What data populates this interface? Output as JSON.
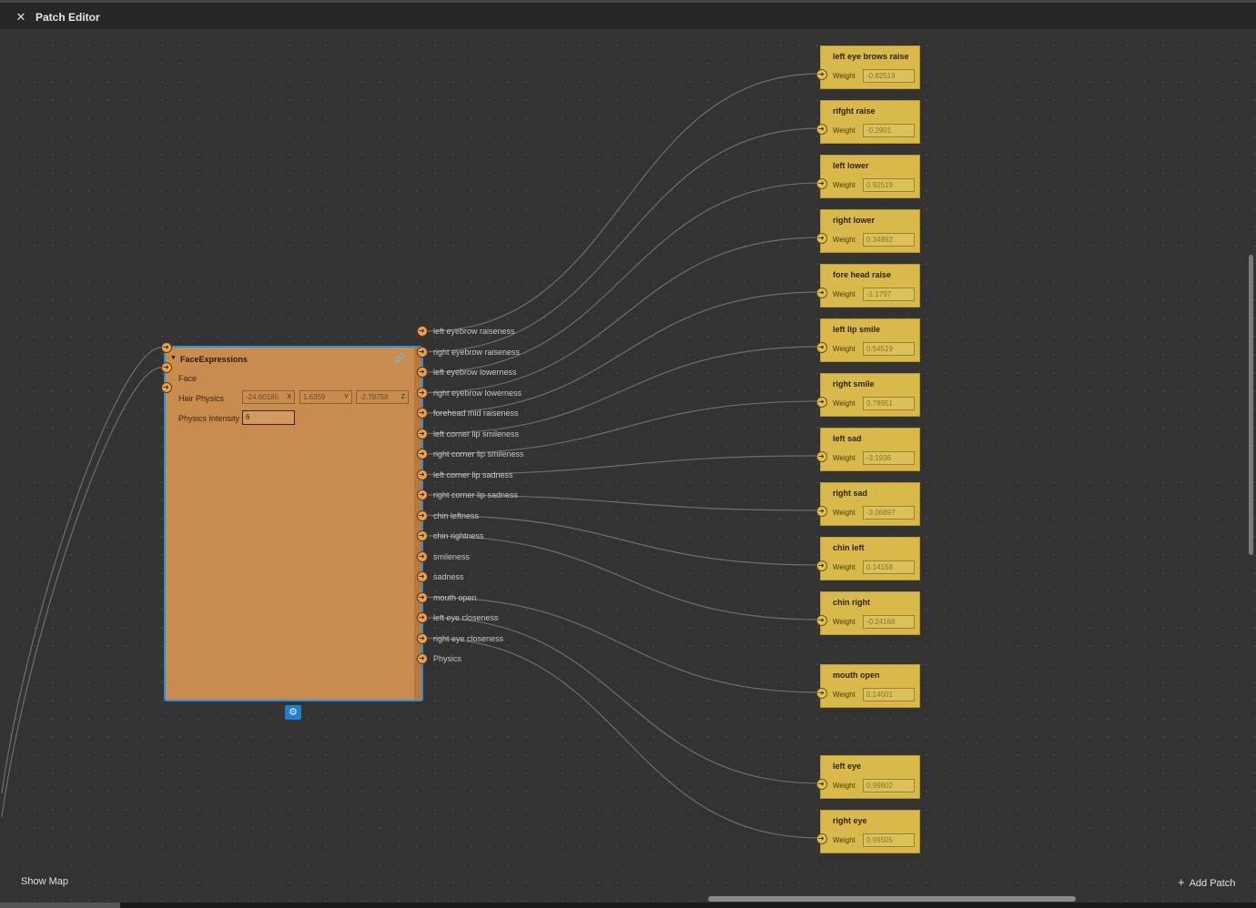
{
  "window": {
    "title": "Patch Editor"
  },
  "face_node": {
    "title": "FaceExpressions",
    "inputs": [
      {
        "label": "Face"
      },
      {
        "label": "Hair Physics",
        "x": "-24.60185",
        "y": "1.6359",
        "z": "-2.78758",
        "x_axis": "X",
        "y_axis": "Y",
        "z_axis": "Z"
      },
      {
        "label": "Physics Intensity",
        "value": "6"
      }
    ],
    "outputs": [
      "left eyebrow raiseness",
      "right eyebrow raiseness",
      "left eyebrow lowerness",
      "right eyebrow lowerness",
      "forehead mid raiseness",
      "left corner lip smileness",
      "right corner lip smileness",
      "left corner lip sadness",
      "right corner lip sadness",
      "chin leftness",
      "chin rightness",
      "smileness",
      "sadness",
      "mouth open",
      "left eye closeness",
      "right eye closeness",
      "Physics"
    ]
  },
  "weight_nodes": [
    {
      "title": "left eye brows raise",
      "label": "Weight",
      "value": "-0.82519"
    },
    {
      "title": "rifght raise",
      "label": "Weight",
      "value": "-0.2901"
    },
    {
      "title": "left lower",
      "label": "Weight",
      "value": "0.92519"
    },
    {
      "title": "right lower",
      "label": "Weight",
      "value": "0.34892"
    },
    {
      "title": "fore head raise",
      "label": "Weight",
      "value": "-1.1797"
    },
    {
      "title": "left lip smile",
      "label": "Weight",
      "value": "0.54519"
    },
    {
      "title": "right smile",
      "label": "Weight",
      "value": "0.78951"
    },
    {
      "title": "left sad",
      "label": "Weight",
      "value": "-3.1936"
    },
    {
      "title": "right sad",
      "label": "Weight",
      "value": "-3.06897"
    },
    {
      "title": "chin left",
      "label": "Weight",
      "value": "0.14168"
    },
    {
      "title": "chin right",
      "label": "Weight",
      "value": "-0.24168"
    },
    {
      "title": "mouth open",
      "label": "Weight",
      "value": "0.14501"
    },
    {
      "title": "left eye",
      "label": "Weight",
      "value": "0.99802"
    },
    {
      "title": "right eye",
      "label": "Weight",
      "value": "0.99505"
    }
  ],
  "footer": {
    "show_map": "Show Map",
    "add_patch": "Add Patch"
  },
  "icons": {
    "close": "close-icon",
    "collapse": "triangle-down-icon",
    "link": "link-icon",
    "settings": "gear-icon",
    "add": "plus-icon"
  },
  "colors": {
    "face_node": "#c98c4f",
    "weight_node": "#d9b94a",
    "selection": "#2d8fe0",
    "background": "#333333"
  }
}
